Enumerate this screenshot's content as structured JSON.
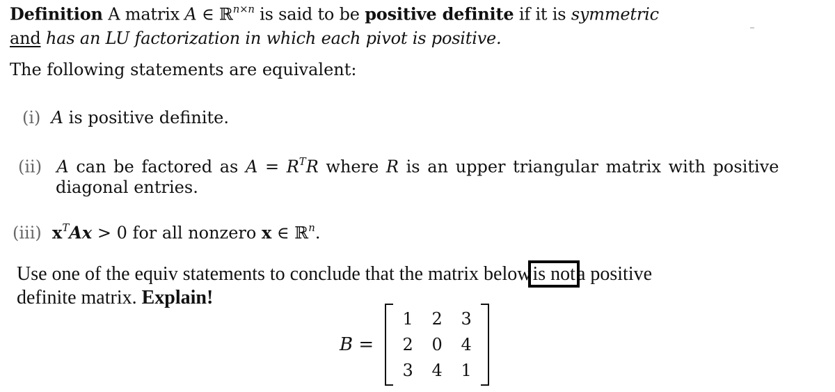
{
  "definition": {
    "label": "Definition",
    "text_a": " A matrix ",
    "math_A": "A",
    "math_in": " ∈ ℝ",
    "math_sup": "n×n",
    "text_b": " is said to be ",
    "bold_term": "positive definite",
    "text_c": " if it is ",
    "italic_symmetric": "symmetric",
    "line2_underlined": "and",
    "line2_italic": " has an LU factorization in which each pivot is positive."
  },
  "equiv_intro": "The following statements are equivalent:",
  "statements": [
    {
      "label": "(i)",
      "math_A": "A",
      "text": " is positive definite."
    },
    {
      "label": "(ii)",
      "math_A": "A",
      "text_a": " can be factored as ",
      "math_eq": "A = R",
      "math_sup": "T",
      "math_R": "R",
      "text_b": " where ",
      "math_R2": "R",
      "text_c": " is an upper triangular matrix with positive",
      "line2": "diagonal entries."
    },
    {
      "label": "(iii)",
      "math_x": "x",
      "math_sup": "T",
      "math_Ax": "Ax",
      "text_a": " > 0 for all nonzero ",
      "math_x2": "x",
      "math_in": " ∈ ℝ",
      "math_n": "n",
      "period": "."
    }
  ],
  "question": {
    "line1_a": "Use one of the equiv statements to conclude that the matrix below",
    "line1_boxed": "is not",
    "line1_b": "a positive",
    "line2_a": "definite matrix. ",
    "line2_bold": "Explain!"
  },
  "matrix": {
    "name": "B",
    "equals": "=",
    "rows": [
      [
        "1",
        "2",
        "3"
      ],
      [
        "2",
        "0",
        "4"
      ],
      [
        "3",
        "4",
        "1"
      ]
    ]
  }
}
